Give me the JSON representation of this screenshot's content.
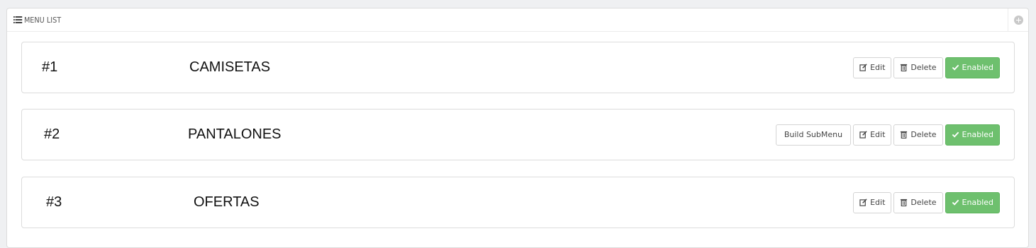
{
  "panel": {
    "title": "MENU LIST",
    "title_icon": "list-icon",
    "add_icon": "plus-circle-icon"
  },
  "menus": [
    {
      "number": "#1",
      "name": "CAMISETAS",
      "edit_label": "Edit",
      "delete_label": "Delete",
      "status_label": "Enabled"
    },
    {
      "number": "#2",
      "name": "PANTALONES",
      "submenu_label": "Build SubMenu",
      "edit_label": "Edit",
      "delete_label": "Delete",
      "status_label": "Enabled"
    },
    {
      "number": "#3",
      "name": "OFERTAS",
      "edit_label": "Edit",
      "delete_label": "Delete",
      "status_label": "Enabled"
    }
  ],
  "colors": {
    "enabled_button": "#6ec06e",
    "page_background": "#eff0f2"
  }
}
